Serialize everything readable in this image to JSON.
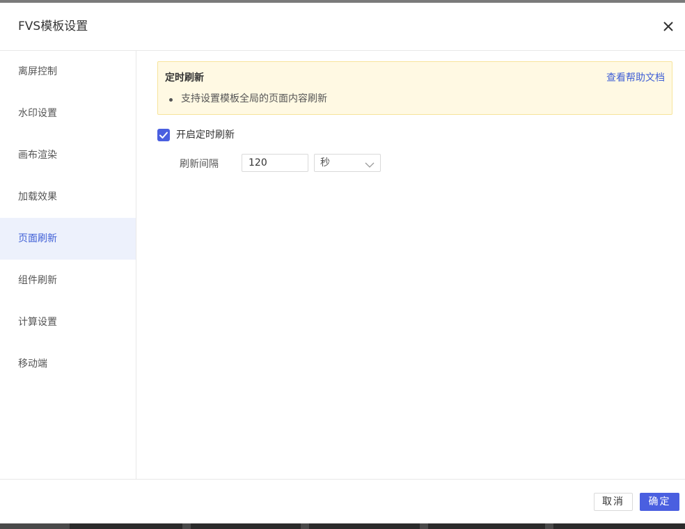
{
  "dialog": {
    "title": "FVS模板设置",
    "close_icon": "close-icon"
  },
  "sidebar": {
    "items": [
      {
        "label": "离屏控制",
        "active": false
      },
      {
        "label": "水印设置",
        "active": false
      },
      {
        "label": "画布渲染",
        "active": false
      },
      {
        "label": "加载效果",
        "active": false
      },
      {
        "label": "页面刷新",
        "active": true
      },
      {
        "label": "组件刷新",
        "active": false
      },
      {
        "label": "计算设置",
        "active": false
      },
      {
        "label": "移动端",
        "active": false
      }
    ]
  },
  "notice": {
    "title": "定时刷新",
    "help_link": "查看帮助文档",
    "bullet": "支持设置模板全局的页面内容刷新"
  },
  "refresh": {
    "enable_label": "开启定时刷新",
    "enabled": true,
    "interval_label": "刷新间隔",
    "interval_value": "120",
    "unit": "秒",
    "unit_icon": "chevron-down-icon"
  },
  "footer": {
    "cancel_label": "取消",
    "ok_label": "确定"
  },
  "colors": {
    "accent": "#4a5fe0",
    "link": "#3f5fd6",
    "active_bg": "#edf1fc",
    "notice_bg": "#fff9e3",
    "notice_border": "#f7e49a"
  }
}
